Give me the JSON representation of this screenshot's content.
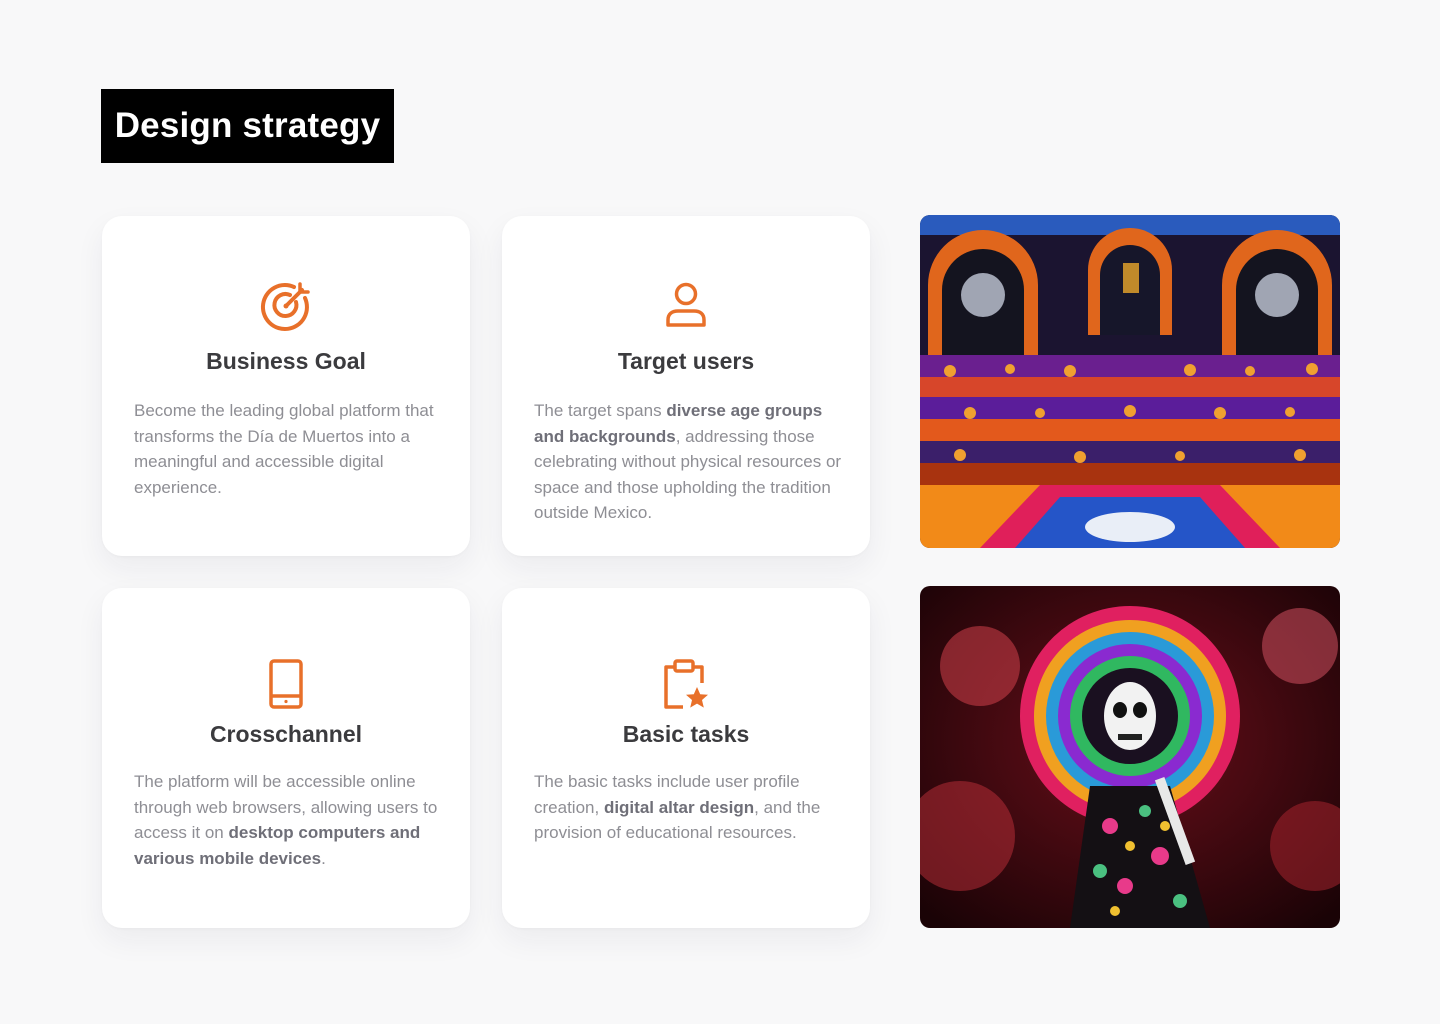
{
  "header": {
    "title": "Design strategy"
  },
  "cards": [
    {
      "icon": "target-icon",
      "title": "Business Goal",
      "body": [
        {
          "text": "Become the leading global platform that transforms the Día de Muertos into a meaningful and accessible digital experience."
        }
      ]
    },
    {
      "icon": "user-icon",
      "title": "Target users",
      "body": [
        {
          "text": "The target spans "
        },
        {
          "text": "diverse age groups and backgrounds",
          "bold": true
        },
        {
          "text": ", addressing those celebrating without physical resources or space and those upholding the tradition outside Mexico."
        }
      ]
    },
    {
      "icon": "smartphone-icon",
      "title": "Crosschannel",
      "body": [
        {
          "text": "The platform will be accessible online through web browsers, allowing users to access it on "
        },
        {
          "text": "desktop computers and various mobile devices",
          "bold": true
        },
        {
          "text": "."
        }
      ]
    },
    {
      "icon": "clipboard-star-icon",
      "title": "Basic tasks",
      "body": [
        {
          "text": "The basic tasks include user profile creation, "
        },
        {
          "text": "digital altar design",
          "bold": true
        },
        {
          "text": ", and the provision of educational resources."
        }
      ]
    }
  ],
  "images": [
    {
      "name": "altar-photo",
      "description": "Día de Muertos altar"
    },
    {
      "name": "catrina-photo",
      "description": "Catrina portrait"
    }
  ],
  "colors": {
    "accent": "#e8702a",
    "heading": "#3b3b3e",
    "body": "#8e8e94",
    "title_bg": "#000000",
    "page_bg": "#f8f8f9"
  }
}
